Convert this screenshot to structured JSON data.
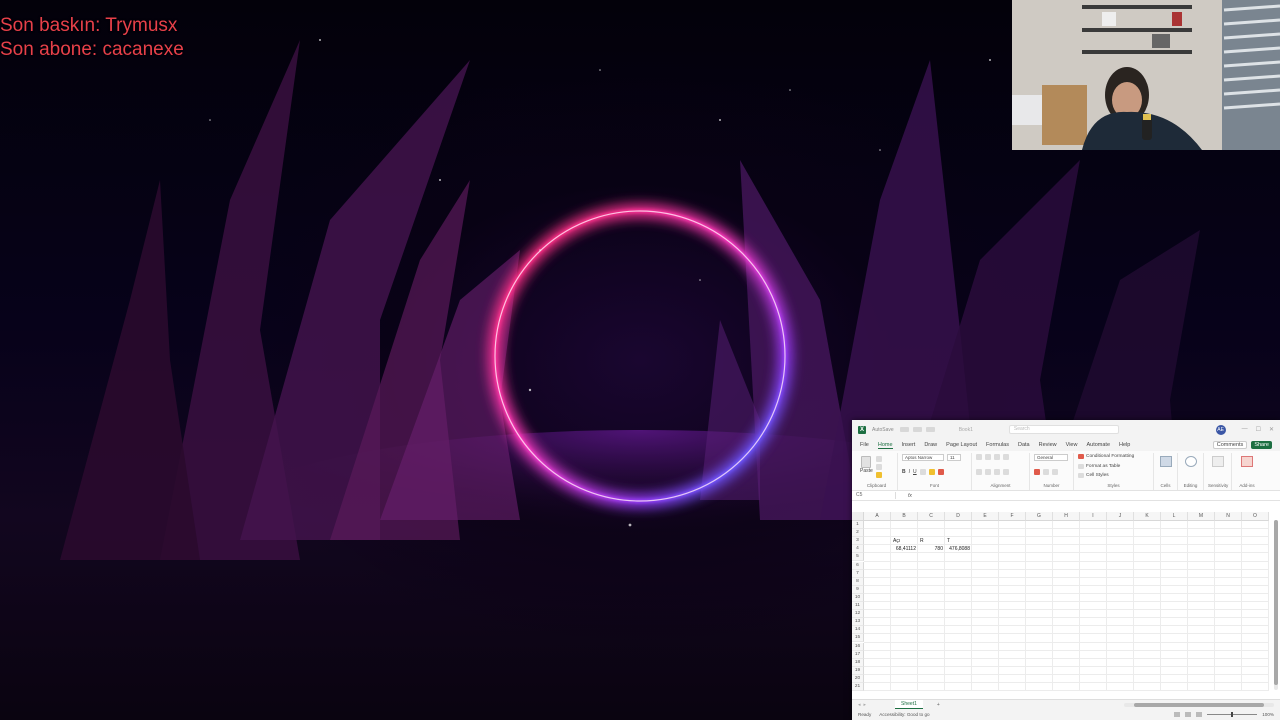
{
  "overlay": {
    "last_raid": "Son baskın: Trymusx",
    "last_sub": "Son abone: cacanexe",
    "text_color": "#e8404a"
  },
  "webcam": {
    "name": "webcam-feed"
  },
  "excel": {
    "title_bar": {
      "autosave": "AutoSave",
      "doc_title": "Book1",
      "search_placeholder": "Search",
      "user_initials": "AE"
    },
    "menu_tabs": [
      "File",
      "Home",
      "Insert",
      "Draw",
      "Page Layout",
      "Formulas",
      "Data",
      "Review",
      "View",
      "Automate",
      "Help"
    ],
    "active_tab": "Home",
    "comments_label": "Comments",
    "share_label": "Share",
    "ribbon": {
      "paste_label": "Paste",
      "clipboard_label": "Clipboard",
      "font_name": "Aptos Narrow",
      "font_size": "11",
      "font_label": "Font",
      "alignment_label": "Alignment",
      "number_format": "General",
      "number_label": "Number",
      "conditional_formatting": "Conditional Formatting",
      "format_as_table": "Format as Table",
      "cell_styles": "Cell Styles",
      "styles_label": "Styles",
      "cells_label": "Cells",
      "editing_label": "Editing",
      "sensitivity_label": "Sensitivity",
      "addins_label": "Add-ins",
      "addins_group_label": "Add-ins"
    },
    "formula_bar": {
      "name_box": "C5",
      "fx": "fx"
    },
    "columns": [
      "A",
      "B",
      "C",
      "D",
      "E",
      "F",
      "G",
      "H",
      "I",
      "J",
      "K",
      "L",
      "M",
      "N",
      "O"
    ],
    "rows": [
      "1",
      "2",
      "3",
      "4",
      "5",
      "6",
      "7",
      "8",
      "9",
      "10",
      "11",
      "12",
      "13",
      "14",
      "15",
      "16",
      "17",
      "18",
      "19",
      "20",
      "21"
    ],
    "cells": [
      {
        "ref": "B3",
        "value": "Açı"
      },
      {
        "ref": "C3",
        "value": "R"
      },
      {
        "ref": "D3",
        "value": "T"
      },
      {
        "ref": "B4",
        "value": "68,41112"
      },
      {
        "ref": "C4",
        "value": "780"
      },
      {
        "ref": "D4",
        "value": "476,8088"
      }
    ],
    "sheet_tab": "Sheet1",
    "add_sheet": "+",
    "status": {
      "ready": "Ready",
      "accessibility": "Accessibility: Good to go",
      "zoom": "100%"
    },
    "accent_color": "#1d6f42"
  }
}
